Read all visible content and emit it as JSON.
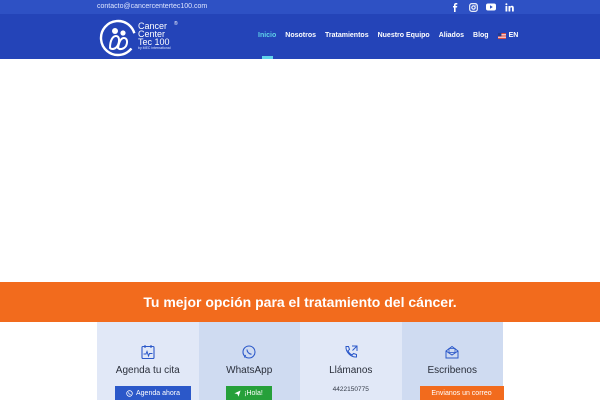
{
  "topbar": {
    "email": "contacto@cancercentertec100.com",
    "socials": [
      "facebook-icon",
      "instagram-icon",
      "youtube-icon",
      "linkedin-icon"
    ]
  },
  "logo": {
    "line1": "Cancer",
    "line2": "Center",
    "line3": "Tec 100",
    "reg": "®",
    "sub": "by MEC international"
  },
  "nav": {
    "items": [
      "Inicio",
      "Nosotros",
      "Tratamientos",
      "Nuestro Equipo",
      "Aliados",
      "Blog"
    ],
    "active": "Inicio",
    "lang": "EN"
  },
  "banner": {
    "text": "Tu mejor opción para el tratamiento del cáncer."
  },
  "cards": [
    {
      "title": "Agenda tu cita",
      "button": "Agenda ahora",
      "icon": "calendar-pulse-icon"
    },
    {
      "title": "WhatsApp",
      "button": "¡Hola!",
      "icon": "whatsapp-icon"
    },
    {
      "title": "Llámanos",
      "phone": "4422150775",
      "icon": "phone-call-icon"
    },
    {
      "title": "Escribenos",
      "button": "Envianos un correo",
      "icon": "envelope-icon"
    }
  ],
  "colors": {
    "topbar": "#2e51c4",
    "header": "#2444b8",
    "accent": "#5fd3ea",
    "banner": "#f26b1d",
    "button_blue": "#2b58c9",
    "button_green": "#26a03a"
  }
}
